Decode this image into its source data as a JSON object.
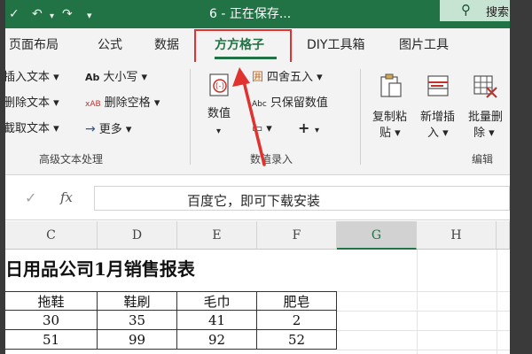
{
  "window": {
    "doc_title": "6 - 正在保存...",
    "search_label": "搜索"
  },
  "tabs": [
    "页面布局",
    "公式",
    "数据",
    "方方格子",
    "DIY工具箱",
    "图片工具"
  ],
  "active_tab": "方方格子",
  "ribbon": {
    "advanced_text": {
      "items_left": [
        "插入文本",
        "删除文本",
        "截取文本"
      ],
      "items_mid": [
        "大小写",
        "删除空格",
        "更多"
      ],
      "mid_icons": [
        "Ab",
        "xAB",
        "→"
      ],
      "label": "高级文本处理"
    },
    "numeric": {
      "value_button": "数值",
      "items": [
        "四舍五入",
        "只保留数值"
      ],
      "round_icon": "囲",
      "keep_icon": "Abc",
      "label": "数值录入"
    },
    "edit": {
      "buttons": [
        {
          "line1": "复制粘",
          "line2": "贴"
        },
        {
          "line1": "新增插",
          "line2": "入"
        },
        {
          "line1": "批量删",
          "line2": "除"
        }
      ],
      "label": "编辑"
    }
  },
  "formula_bar": {
    "value": "百度它，即可下载安装",
    "fx": "fx"
  },
  "sheet": {
    "columns": [
      "C",
      "D",
      "E",
      "F",
      "G",
      "H"
    ],
    "selected_column": "G",
    "title": "日用品公司1月销售报表",
    "headers": [
      "拖鞋",
      "鞋刷",
      "毛巾",
      "肥皂"
    ],
    "rows": [
      [
        "30",
        "35",
        "41",
        "2"
      ],
      [
        "51",
        "99",
        "92",
        "52"
      ]
    ]
  },
  "colors": {
    "excel_green": "#217346",
    "highlight_red": "#e0322f"
  }
}
